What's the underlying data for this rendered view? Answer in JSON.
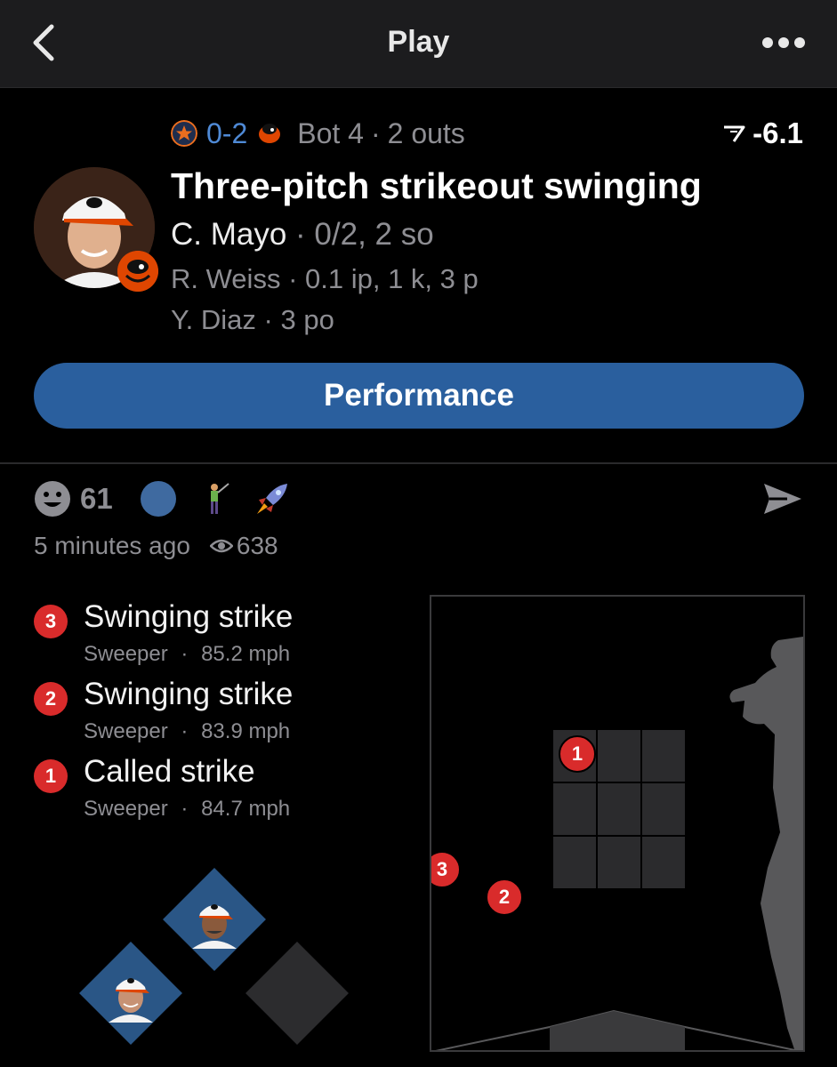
{
  "nav": {
    "title": "Play"
  },
  "game": {
    "score": "0-2",
    "inning": "Bot 4",
    "separator": "·",
    "outs": "2 outs",
    "win_prob_delta": "-6.1",
    "away_team_color": "#eb6e1f",
    "home_team_color": "#df4601"
  },
  "play": {
    "headline": "Three-pitch strikeout swinging",
    "batter": {
      "name": "C. Mayo",
      "stat": "· 0/2, 2 so"
    },
    "pitcher": {
      "name": "R. Weiss",
      "stat": "· 0.1 ip, 1 k, 3 p"
    },
    "fielder": {
      "name": "Y. Diaz",
      "stat": "· 3 po"
    }
  },
  "performance_button": {
    "label": "Performance",
    "color": "#2a5f9e"
  },
  "reactions": {
    "smile_count": "61",
    "icons": [
      "smile-icon",
      "blue-circle-icon",
      "golfer-icon",
      "rocket-icon"
    ]
  },
  "meta": {
    "time_ago": "5 minutes ago",
    "views": "638"
  },
  "pitches": [
    {
      "number": "3",
      "result": "Swinging strike",
      "type": "Sweeper",
      "dot": "·",
      "speed": "85.2 mph"
    },
    {
      "number": "2",
      "result": "Swinging strike",
      "type": "Sweeper",
      "dot": "·",
      "speed": "83.9 mph"
    },
    {
      "number": "1",
      "result": "Called strike",
      "type": "Sweeper",
      "dot": "·",
      "speed": "84.7 mph"
    }
  ],
  "strike_zone": {
    "markers": [
      {
        "label": "1"
      },
      {
        "label": "2"
      },
      {
        "label": "3"
      }
    ]
  },
  "colors": {
    "accent_blue": "#4f8ad6",
    "pitch_marker": "#d92b2b"
  }
}
